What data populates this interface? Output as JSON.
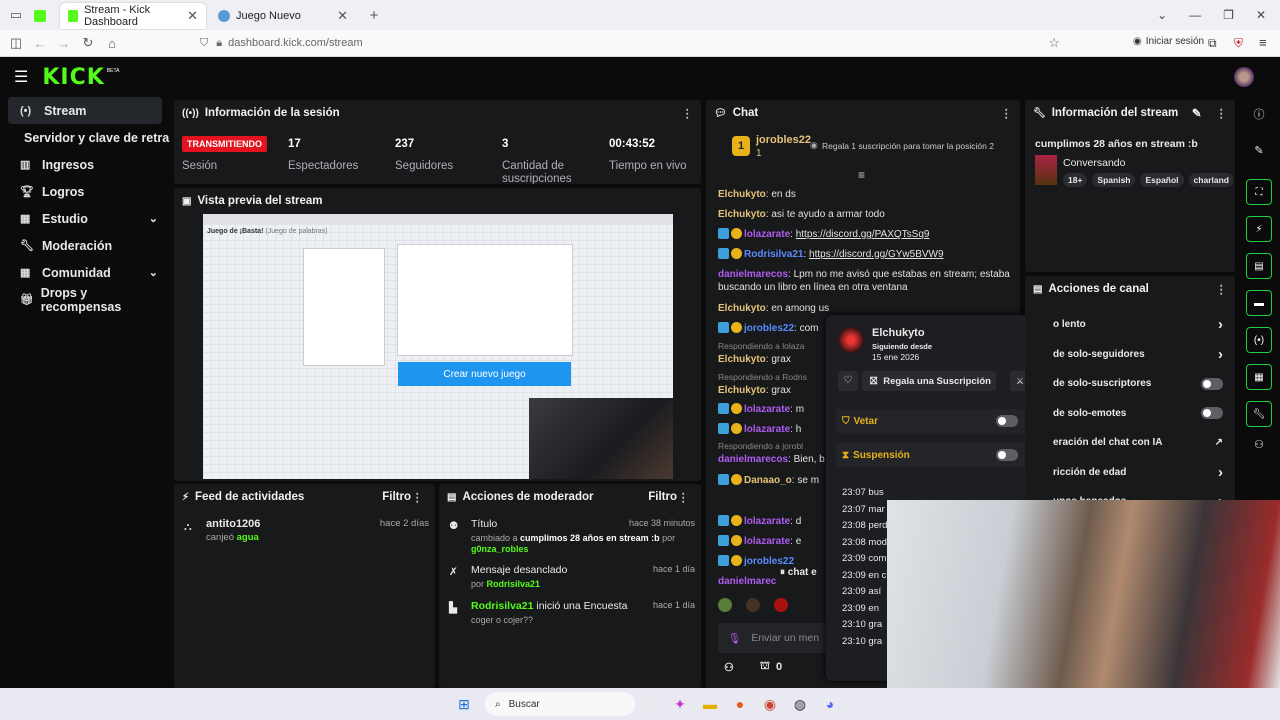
{
  "browser": {
    "tabs": [
      {
        "label": "Stream - Kick Dashboard"
      },
      {
        "label": "Juego Nuevo"
      }
    ],
    "url": "dashboard.kick.com/stream",
    "signin": "Iniciar sesión"
  },
  "brand": {
    "logo": "KICK",
    "beta": "BETA"
  },
  "sidebar": {
    "items": [
      {
        "label": "Stream",
        "icon": "broadcast-icon"
      },
      {
        "label": "Servidor y clave de retransmisión"
      },
      {
        "label": "Ingresos",
        "icon": "chart-icon"
      },
      {
        "label": "Logros",
        "icon": "trophy-icon"
      },
      {
        "label": "Estudio",
        "icon": "grid-icon"
      },
      {
        "label": "Moderación",
        "icon": "wrench-icon"
      },
      {
        "label": "Comunidad",
        "icon": "grid-icon"
      },
      {
        "label": "Drops y recompensas",
        "icon": "gift-icon"
      }
    ]
  },
  "session": {
    "title": "Información de la sesión",
    "live": "TRANSMITIENDO",
    "live_label": "Sesión",
    "viewers": "17",
    "viewers_label": "Espectadores",
    "followers": "237",
    "followers_label": "Seguidores",
    "subs": "3",
    "subs_label": "Cantidad de suscripciones",
    "uptime": "00:43:52",
    "uptime_label": "Tiempo en vivo"
  },
  "preview": {
    "title": "Vista previa del stream",
    "game_title": "Juego de ¡Basta!",
    "game_sub": "(Juego de palabras)",
    "create_btn": "Crear nuevo juego"
  },
  "activity": {
    "title": "Feed de actividades",
    "filter": "Filtro",
    "user": "antito1206",
    "action": "canjeó",
    "item": "agua",
    "time": "hace 2 días"
  },
  "modactions": {
    "title": "Acciones de moderador",
    "filter": "Filtro",
    "items": [
      {
        "title": "Título",
        "time": "hace 38 minutos",
        "desc": "cambiado a",
        "desc_value": "cumplimos 28 años en stream :b",
        "desc2": "por",
        "by": "g0nza_robles"
      },
      {
        "title": "Mensaje desanclado",
        "time": "hace 1 día",
        "desc": "por",
        "by": "Rodrisilva21"
      },
      {
        "title_user": "Rodrisilva21",
        "title": "inició una Encuesta",
        "time": "hace 1 día",
        "desc": "coger o cojer??"
      }
    ]
  },
  "chat": {
    "title": "Chat",
    "top_user": "jorobles22",
    "top_count": "1",
    "gift_text": "Regala 1 suscripción para tomar la posición 2",
    "messages": [
      {
        "user": "Elchukyto",
        "text": "en ds",
        "color": "#e6c37a"
      },
      {
        "user": "Elchukyto",
        "text": "asi te ayudo a armar todo",
        "color": "#e6c37a"
      },
      {
        "user": "lolazarate",
        "text": "https://discord.gg/PAXQTsSq9",
        "color": "#b05cf0"
      },
      {
        "user": "Rodrisilva21",
        "text": "https://discord.gg/GYw5BVW9",
        "color": "#5a8cff"
      },
      {
        "user": "danielmarecos",
        "text": "Lpm no me avisó que estabas en stream; estaba",
        "color": "#b05cf0"
      },
      {
        "user": "",
        "text": "buscando un libro en línea en otra ventana",
        "color": "#e6c37a"
      },
      {
        "user": "Elchukyto",
        "text": "en among us",
        "color": "#e6c37a"
      },
      {
        "user": "jorobles22",
        "text": "com",
        "color": "#5a8cff"
      },
      {
        "user": "",
        "text": "Respondiendo a lolaza",
        "color": "#777"
      },
      {
        "user": "Elchukyto",
        "text": "grax",
        "color": "#e6c37a"
      },
      {
        "user": "",
        "text": "Respondiendo a Rodris",
        "color": "#777"
      },
      {
        "user": "Elchukyto",
        "text": "grax",
        "color": "#e6c37a"
      },
      {
        "user": "lolazarate",
        "text": "m",
        "color": "#b05cf0"
      },
      {
        "user": "lolazarate",
        "text": "h",
        "color": "#b05cf0"
      },
      {
        "user": "",
        "text": "Respondiendo a jorobl",
        "color": "#777"
      },
      {
        "user": "danielmarecos",
        "text": "Bien, b",
        "color": "#b05cf0"
      },
      {
        "user": "Danaao_o",
        "text": "se m",
        "color": "#e6c37a"
      }
    ],
    "messages2": [
      {
        "user": "lolazarate",
        "text": "d"
      },
      {
        "user": "lolazarate",
        "text": "e"
      },
      {
        "user": "jorobles22",
        "text": ""
      },
      {
        "user": "danielmarec",
        "text": ""
      }
    ],
    "paused": "chat e",
    "input_placeholder": "Enviar un men",
    "points": "0"
  },
  "usercard": {
    "name": "Elchukyto",
    "since_label": "Siguiendo desde",
    "since": "15 ene 2026",
    "gift_btn": "Regala una Suscripción",
    "veto": "Vetar",
    "suspension": "Suspensión",
    "times": [
      "23:07 bus",
      "23:07 mar",
      "23:08 perd",
      "23:08 mod",
      "23:09 com",
      "23:09 en c",
      "23:09 así",
      "23:09 en",
      "23:10 gra",
      "23:10 gra"
    ]
  },
  "streaminfo": {
    "title": "Información del stream",
    "stream_title": "cumplimos 28 años en stream :b",
    "category": "Conversando",
    "tags": [
      "18+",
      "Spanish",
      "Español",
      "charland"
    ]
  },
  "channel": {
    "title": "Acciones de canal",
    "items": [
      "o lento",
      "de solo-seguidores",
      "de solo-suscriptores",
      "de solo-emotes",
      "eración del chat con IA",
      "ricción de edad",
      "unos baneados"
    ]
  },
  "taskbar": {
    "search": "Buscar"
  },
  "colors": {
    "kick_green": "#53fc18",
    "live_red": "#e3141f"
  }
}
